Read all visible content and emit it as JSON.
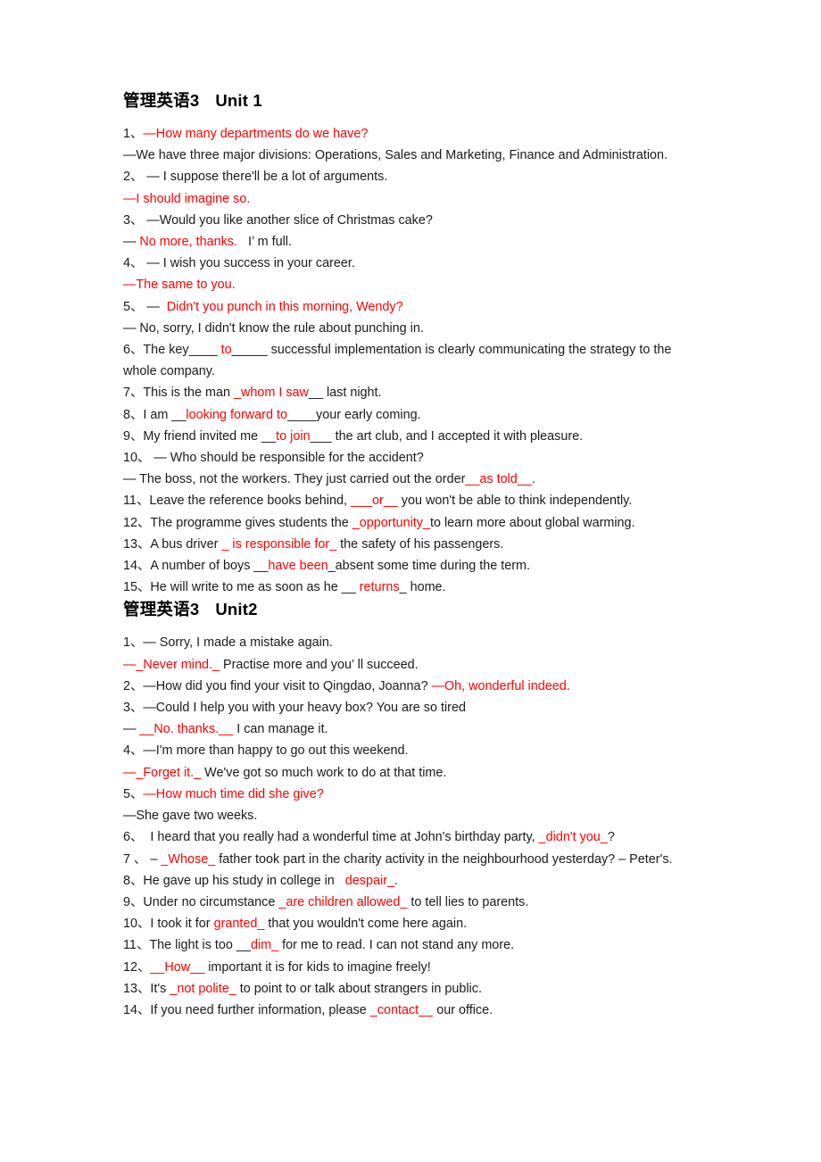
{
  "document": {
    "sections": [
      {
        "heading": {
          "course": "管理英语",
          "level": "3",
          "unit": "Unit 1"
        },
        "lines": [
          {
            "id": "u1-q1",
            "parts": [
              {
                "text": "1、",
                "color": "black"
              },
              {
                "text": "—How many departments do we have?",
                "color": "red"
              }
            ]
          },
          {
            "id": "u1-a1",
            "parts": [
              {
                "text": "—We have three major divisions: Operations, Sales and Marketing, Finance and Administration.",
                "color": "black"
              }
            ]
          },
          {
            "id": "u1-q2",
            "parts": [
              {
                "text": "2、 — I suppose there'll be a lot of arguments.",
                "color": "black"
              }
            ]
          },
          {
            "id": "u1-a2",
            "parts": [
              {
                "text": "—I should imagine so.",
                "color": "red"
              }
            ]
          },
          {
            "id": "u1-q3",
            "parts": [
              {
                "text": "3、 —Would you like another slice of Christmas cake?",
                "color": "black"
              }
            ]
          },
          {
            "id": "u1-a3",
            "parts": [
              {
                "text": "— ",
                "color": "black"
              },
              {
                "text": "No more, thanks.",
                "color": "red"
              },
              {
                "text": "   I’ m full.",
                "color": "black"
              }
            ]
          },
          {
            "id": "u1-q4",
            "parts": [
              {
                "text": "4、 — I wish you success in your career.",
                "color": "black"
              }
            ]
          },
          {
            "id": "u1-a4",
            "parts": [
              {
                "text": "—The same to you.",
                "color": "red"
              }
            ]
          },
          {
            "id": "u1-q5",
            "parts": [
              {
                "text": "5、 — ",
                "color": "black"
              },
              {
                "text": " Didn't you punch in this morning, Wendy?",
                "color": "red"
              }
            ]
          },
          {
            "id": "u1-a5",
            "parts": [
              {
                "text": "— No, sorry, I didn't know the rule about punching in.",
                "color": "black"
              }
            ]
          },
          {
            "id": "u1-q6",
            "parts": [
              {
                "text": "6、The key____ ",
                "color": "black"
              },
              {
                "text": "to",
                "color": "red"
              },
              {
                "text": "_____ successful implementation is clearly communicating the strategy to the whole company.",
                "color": "black"
              }
            ]
          },
          {
            "id": "u1-q7",
            "parts": [
              {
                "text": "7、This is the man ",
                "color": "black"
              },
              {
                "text": "_whom I saw",
                "color": "red"
              },
              {
                "text": "__ last night.",
                "color": "black"
              }
            ]
          },
          {
            "id": "u1-q8",
            "parts": [
              {
                "text": "8、I am __",
                "color": "black"
              },
              {
                "text": "looking forward to",
                "color": "red"
              },
              {
                "text": "____your early coming.",
                "color": "black"
              }
            ]
          },
          {
            "id": "u1-q9",
            "parts": [
              {
                "text": "9、My friend invited me __",
                "color": "black"
              },
              {
                "text": "to join",
                "color": "red"
              },
              {
                "text": "___ the art club, and I accepted it with pleasure.",
                "color": "black"
              }
            ]
          },
          {
            "id": "u1-q10",
            "parts": [
              {
                "text": "10、 — Who should be responsible for the accident?",
                "color": "black"
              }
            ]
          },
          {
            "id": "u1-a10",
            "parts": [
              {
                "text": "— The boss, not the workers. They just carried out the order",
                "color": "black"
              },
              {
                "text": "__as told__",
                "color": "red"
              },
              {
                "text": ".",
                "color": "black"
              }
            ]
          },
          {
            "id": "u1-q11",
            "parts": [
              {
                "text": "11、Leave the reference books behind, ",
                "color": "black"
              },
              {
                "text": "___or__",
                "color": "red"
              },
              {
                "text": " you won't be able to think independently.",
                "color": "black"
              }
            ]
          },
          {
            "id": "u1-q12",
            "parts": [
              {
                "text": "12、The programme gives students the ",
                "color": "black"
              },
              {
                "text": "_opportunity_",
                "color": "red"
              },
              {
                "text": "to learn more about global warming.",
                "color": "black"
              }
            ]
          },
          {
            "id": "u1-q13",
            "parts": [
              {
                "text": "13、A bus driver ",
                "color": "black"
              },
              {
                "text": "_ is responsible for_",
                "color": "red"
              },
              {
                "text": " the safety of his passengers.",
                "color": "black"
              }
            ]
          },
          {
            "id": "u1-q14",
            "parts": [
              {
                "text": "14、A number of boys __",
                "color": "black"
              },
              {
                "text": "have been",
                "color": "red"
              },
              {
                "text": "_absent some time during the term.",
                "color": "black"
              }
            ]
          },
          {
            "id": "u1-q15",
            "parts": [
              {
                "text": "15、He will write to me as soon as he __ ",
                "color": "black"
              },
              {
                "text": "returns",
                "color": "red"
              },
              {
                "text": "_ home.",
                "color": "black"
              }
            ]
          }
        ]
      },
      {
        "heading": {
          "course": "管理英语",
          "level": "3",
          "unit": "Unit2"
        },
        "lines": [
          {
            "id": "u2-q1",
            "parts": [
              {
                "text": "1、— Sorry, I made a mistake again.",
                "color": "black"
              }
            ]
          },
          {
            "id": "u2-a1",
            "parts": [
              {
                "text": "—_Never mind._",
                "color": "red"
              },
              {
                "text": " Practise more and you’ ll succeed.",
                "color": "black"
              }
            ]
          },
          {
            "id": "u2-q2",
            "parts": [
              {
                "text": "2、—How did you find your visit to Qingdao, Joanna? ",
                "color": "black"
              },
              {
                "text": "—Oh, wonderful indeed.",
                "color": "red"
              }
            ]
          },
          {
            "id": "u2-q3",
            "parts": [
              {
                "text": "3、—Could I help you with your heavy box? You are so tired",
                "color": "black"
              }
            ]
          },
          {
            "id": "u2-a3",
            "parts": [
              {
                "text": "— ",
                "color": "black"
              },
              {
                "text": "__No. thanks.__",
                "color": "red"
              },
              {
                "text": " I can manage it.",
                "color": "black"
              }
            ]
          },
          {
            "id": "u2-q4",
            "parts": [
              {
                "text": "4、—I'm more than happy to go out this weekend.",
                "color": "black"
              }
            ]
          },
          {
            "id": "u2-a4",
            "parts": [
              {
                "text": "—_Forget it._",
                "color": "red"
              },
              {
                "text": " We've got so much work to do at that time.",
                "color": "black"
              }
            ]
          },
          {
            "id": "u2-q5",
            "parts": [
              {
                "text": "5、",
                "color": "black"
              },
              {
                "text": "—How much time did she give?",
                "color": "red"
              }
            ]
          },
          {
            "id": "u2-a5",
            "parts": [
              {
                "text": "—She gave two weeks.",
                "color": "black"
              }
            ]
          },
          {
            "id": "u2-q6",
            "parts": [
              {
                "text": "6、  I heard that you really had a wonderful time at John's birthday party, ",
                "color": "black"
              },
              {
                "text": "_didn't you_",
                "color": "red"
              },
              {
                "text": "?",
                "color": "black"
              }
            ]
          },
          {
            "id": "u2-q7",
            "justify": true,
            "parts": [
              {
                "text": "7 、 – ",
                "color": "black"
              },
              {
                "text": "_Whose_",
                "color": "red"
              },
              {
                "text": " father took part in the charity activity in the neighbourhood yesterday? – Peter's.",
                "color": "black"
              }
            ]
          },
          {
            "id": "u2-q8",
            "parts": [
              {
                "text": "8、He gave up his study in college in   ",
                "color": "black"
              },
              {
                "text": "despair_",
                "color": "red"
              },
              {
                "text": ".",
                "color": "black"
              }
            ]
          },
          {
            "id": "u2-q9",
            "parts": [
              {
                "text": "9、Under no circumstance ",
                "color": "black"
              },
              {
                "text": "_are children allowed_",
                "color": "red"
              },
              {
                "text": " to tell lies to parents.",
                "color": "black"
              }
            ]
          },
          {
            "id": "u2-q10",
            "parts": [
              {
                "text": "10、I took it for ",
                "color": "black"
              },
              {
                "text": "granted_",
                "color": "red"
              },
              {
                "text": " that you wouldn't come here again.",
                "color": "black"
              }
            ]
          },
          {
            "id": "u2-q11",
            "parts": [
              {
                "text": "11、The light is too __",
                "color": "black"
              },
              {
                "text": "dim_",
                "color": "red"
              },
              {
                "text": " for me to read. I can not stand any more.",
                "color": "black"
              }
            ]
          },
          {
            "id": "u2-q12",
            "parts": [
              {
                "text": "12、",
                "color": "black"
              },
              {
                "text": "__How__",
                "color": "red"
              },
              {
                "text": " important it is for kids to imagine freely!",
                "color": "black"
              }
            ]
          },
          {
            "id": "u2-q13",
            "parts": [
              {
                "text": "13、It's ",
                "color": "black"
              },
              {
                "text": "_not polite_",
                "color": "red"
              },
              {
                "text": " to point to or talk about strangers in public.",
                "color": "black"
              }
            ]
          },
          {
            "id": "u2-q14",
            "parts": [
              {
                "text": "14、If you need further information, please ",
                "color": "black"
              },
              {
                "text": "_contact__",
                "color": "red"
              },
              {
                "text": " our office.",
                "color": "black"
              }
            ]
          }
        ]
      }
    ]
  },
  "colors": {
    "answer_red": "#ff0000",
    "body_black": "#0d0d0d",
    "page_background": "#ffffff"
  }
}
